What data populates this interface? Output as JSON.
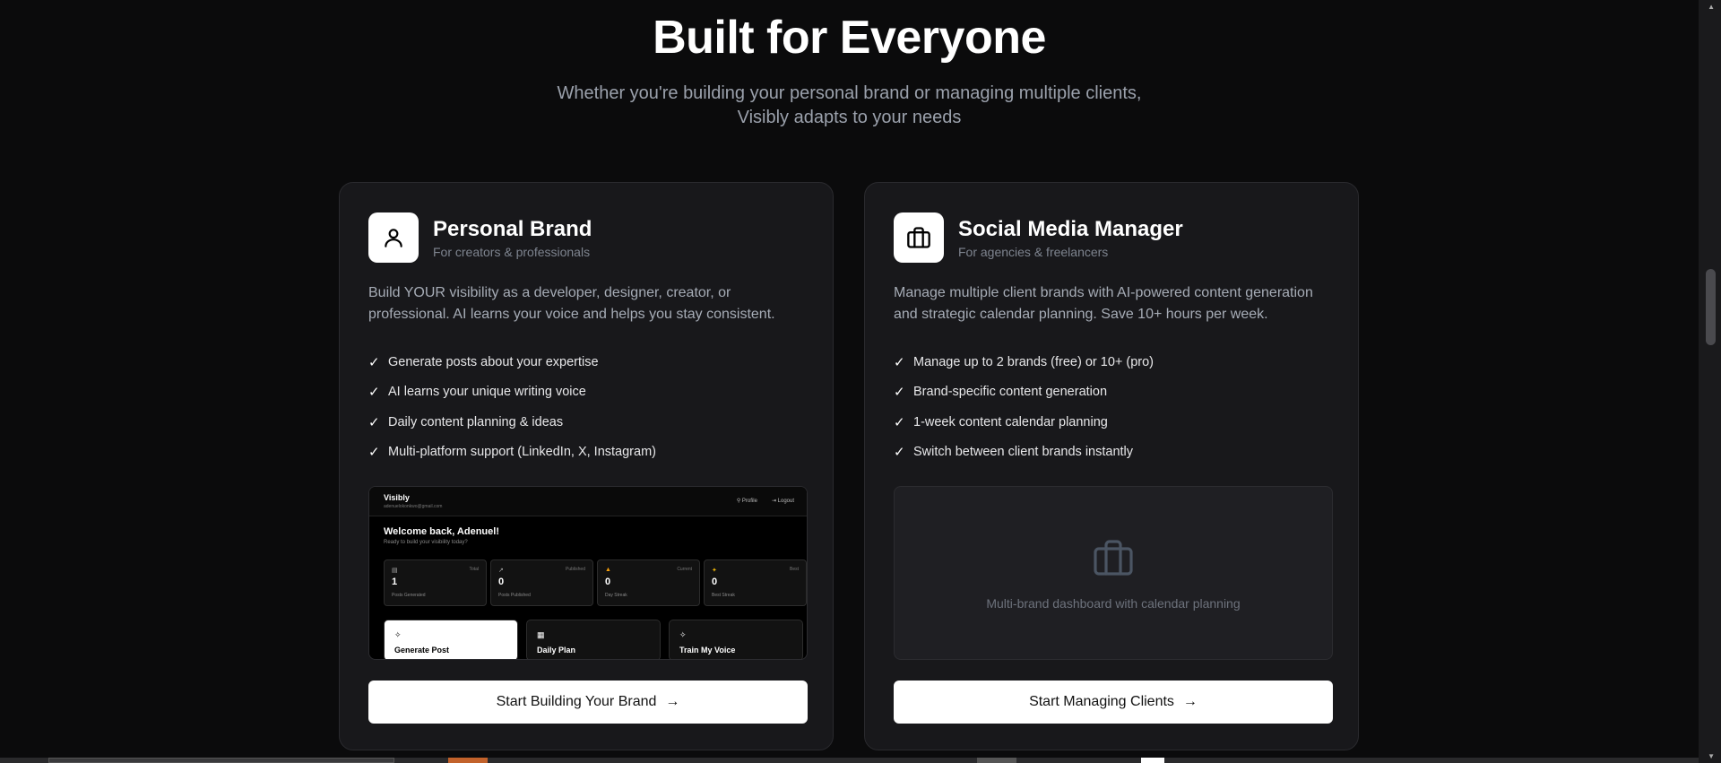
{
  "hero": {
    "title": "Built for Everyone",
    "subtitle_line1": "Whether you're building your personal brand or managing multiple clients,",
    "subtitle_line2": "Visibly adapts to your needs"
  },
  "cards": [
    {
      "title": "Personal Brand",
      "subtitle": "For creators & professionals",
      "icon": "user-icon",
      "description": "Build YOUR visibility as a developer, designer, creator, or professional. AI learns your voice and helps you stay consistent.",
      "features": [
        "Generate posts about your expertise",
        "AI learns your unique writing voice",
        "Daily content planning & ideas",
        "Multi-platform support (LinkedIn, X, Instagram)"
      ],
      "cta": "Start Building Your Brand",
      "preview": {
        "brand": "Visibly",
        "email": "adenuelokonkwo@gmail.com",
        "profile_link": "Profile",
        "logout_link": "Logout",
        "welcome": "Welcome back, Adenuel!",
        "ready": "Ready to build your visibility today?",
        "stats": [
          {
            "tag": "Total",
            "value": "1",
            "label": "Posts Generated",
            "icon": "file-icon"
          },
          {
            "tag": "Published",
            "value": "0",
            "label": "Posts Published",
            "icon": "trend-icon"
          },
          {
            "tag": "Current",
            "value": "0",
            "label": "Day Streak",
            "icon": "flame-icon"
          },
          {
            "tag": "Best",
            "value": "0",
            "label": "Best Streak",
            "icon": "bolt-icon"
          }
        ],
        "actions": [
          {
            "label": "Generate Post",
            "icon": "sparkle-icon"
          },
          {
            "label": "Daily Plan",
            "icon": "calendar-icon"
          },
          {
            "label": "Train My Voice",
            "icon": "sparkle-icon"
          }
        ]
      }
    },
    {
      "title": "Social Media Manager",
      "subtitle": "For agencies & freelancers",
      "icon": "briefcase-icon",
      "description": "Manage multiple client brands with AI-powered content generation and strategic calendar planning. Save 10+ hours per week.",
      "features": [
        "Manage up to 2 brands (free) or 10+ (pro)",
        "Brand-specific content generation",
        "1-week content calendar planning",
        "Switch between client brands instantly"
      ],
      "cta": "Start Managing Clients",
      "placeholder_text": "Multi-brand dashboard with calendar planning"
    }
  ],
  "colors": {
    "background": "#0b0b0c",
    "card": "#18181b",
    "muted": "#9ba1ac"
  }
}
